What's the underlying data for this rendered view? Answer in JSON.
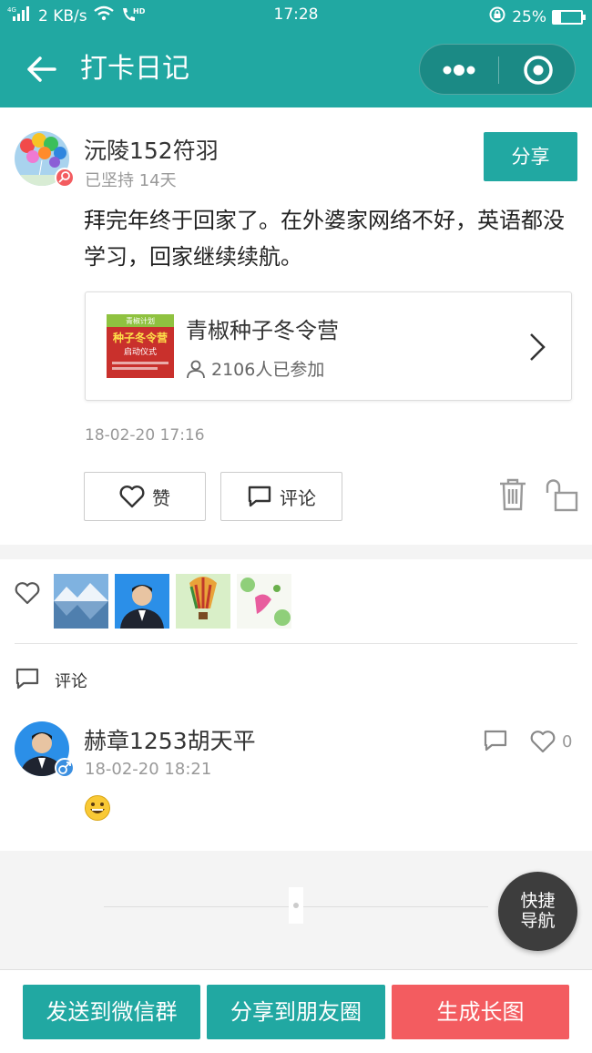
{
  "status_bar": {
    "network": "4G",
    "speed": "2 KB/s",
    "hd": "HD",
    "time": "17:28",
    "battery_level": 0.25,
    "battery_text": "25%"
  },
  "nav": {
    "title": "打卡日记"
  },
  "post": {
    "author": "沅陵152符羽",
    "streak": "已坚持 14天",
    "share_label": "分享",
    "content": "拜完年终于回家了。在外婆家网络不好，英语都没学习，回家继续续航。",
    "camp": {
      "name": "青椒种子冬令营",
      "participants": "2106人已参加",
      "thumb_top": "青椒计划",
      "thumb_main": "种子冬令营",
      "thumb_sub": "启动仪式"
    },
    "time": "18-02-20 17:16",
    "like_label": "赞",
    "comment_label": "评论"
  },
  "likes_section": {
    "comments_heading": "评论",
    "comment": {
      "author": "赫章1253胡天平",
      "time": "18-02-20 18:21",
      "emoji": "😀",
      "like_count": "0"
    }
  },
  "fab": {
    "line1": "快捷",
    "line2": "导航"
  },
  "footer": {
    "send_group": "发送到微信群",
    "share_moments": "分享到朋友圈",
    "generate_image": "生成长图"
  },
  "colors": {
    "primary": "#21a8a2",
    "danger": "#f35c60",
    "fab": "#3d3d3d"
  }
}
